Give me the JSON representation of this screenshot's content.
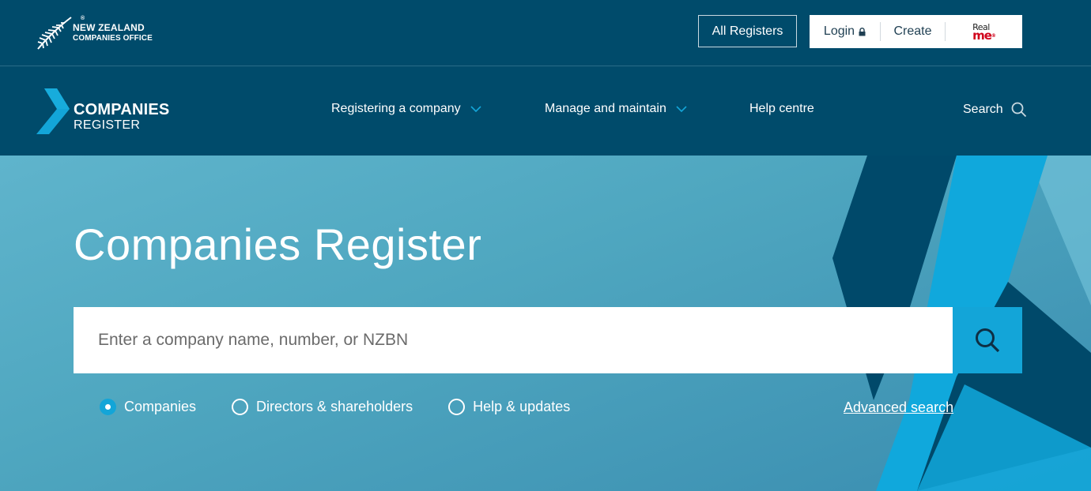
{
  "brand": {
    "org_line1": "NEW ZEALAND",
    "org_line2": "COMPANIES OFFICE",
    "trademark": "®",
    "register_line1": "COMPANIES",
    "register_line2": "REGISTER"
  },
  "topbar": {
    "all_registers": "All Registers",
    "login": "Login",
    "create": "Create",
    "realme_line1": "Real",
    "realme_line2": "me",
    "realme_mark": "®"
  },
  "nav": {
    "items": [
      {
        "label": "Registering a company",
        "has_dropdown": true
      },
      {
        "label": "Manage and maintain",
        "has_dropdown": true
      },
      {
        "label": "Help centre",
        "has_dropdown": false
      }
    ],
    "search_label": "Search"
  },
  "hero": {
    "title": "Companies Register",
    "search_placeholder": "Enter a company name, number, or NZBN",
    "radios": [
      {
        "label": "Companies",
        "checked": true
      },
      {
        "label": "Directors & shareholders",
        "checked": false
      },
      {
        "label": "Help & updates",
        "checked": false
      }
    ],
    "advanced_search": "Advanced search"
  },
  "colors": {
    "header_bg": "#004b6b",
    "accent": "#13a5d8",
    "hero_bg": "#4fa7c0"
  }
}
